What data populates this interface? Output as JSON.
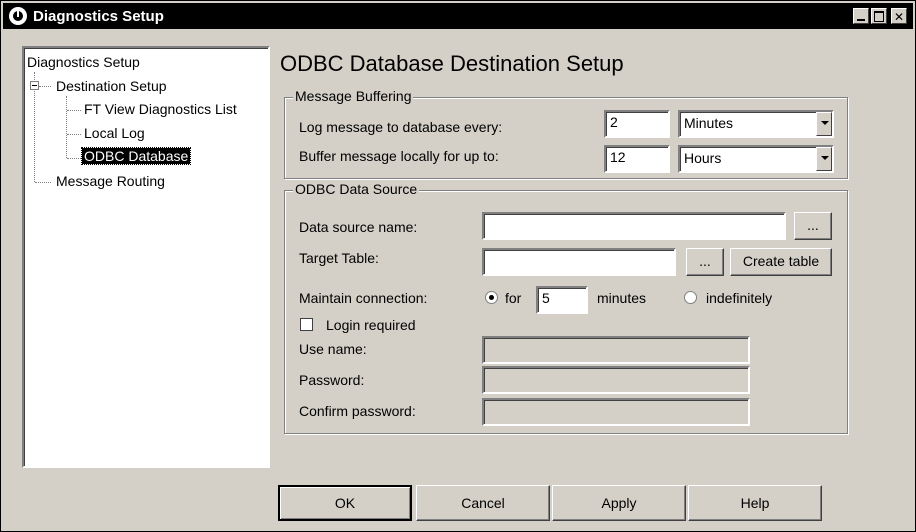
{
  "window": {
    "title": "Diagnostics Setup"
  },
  "tree": {
    "root": "Diagnostics Setup",
    "destination": "Destination Setup",
    "ftview": "FT View Diagnostics List",
    "local_log": "Local Log",
    "odbc": "ODBC Database",
    "routing": "Message Routing"
  },
  "heading": "ODBC Database Destination Setup",
  "buffering": {
    "legend": "Message Buffering",
    "log_label": "Log message to database every:",
    "log_value": "2",
    "log_unit": "Minutes",
    "buffer_label": "Buffer message locally for up to:",
    "buffer_value": "12",
    "buffer_unit": "Hours"
  },
  "odbc_source": {
    "legend": "ODBC Data Source",
    "dsn_label": "Data source name:",
    "dsn_value": "",
    "browse_label": "...",
    "table_label": "Target Table:",
    "table_value": "",
    "create_table_label": "Create table",
    "maintain_label": "Maintain connection:",
    "for_label": "for",
    "minutes_value": "5",
    "minutes_label": "minutes",
    "indefinitely_label": "indefinitely",
    "login_label": "Login required",
    "user_label": "Use name:",
    "password_label": "Password:",
    "confirm_label": "Confirm password:"
  },
  "buttons": {
    "ok": "OK",
    "cancel": "Cancel",
    "apply": "Apply",
    "help": "Help"
  }
}
